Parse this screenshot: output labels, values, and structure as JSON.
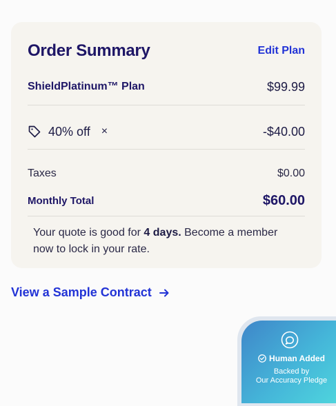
{
  "order_summary": {
    "title": "Order Summary",
    "edit_label": "Edit Plan",
    "plan_name": "ShieldPlatinum™ Plan",
    "plan_price": "$99.99",
    "discount_label": "40% off",
    "discount_remove": "×",
    "discount_amount": "-$40.00",
    "taxes_label": "Taxes",
    "taxes_value": "$0.00",
    "total_label": "Monthly Total",
    "total_value": "$60.00",
    "quote_prefix": "Your quote is good for ",
    "quote_days": "4 days.",
    "quote_suffix": " Become a member now to lock in your rate."
  },
  "contract_link": {
    "label": "View a Sample Contract"
  },
  "badge": {
    "title": "Human Added",
    "line1": "Backed by",
    "line2": "Our Accuracy Pledge"
  },
  "colors": {
    "card_bg": "#f6f4ef",
    "primary_text": "#1e1666",
    "link": "#2233d6",
    "badge_gradient_start": "#3f86c9",
    "badge_gradient_end": "#4fd6dd"
  },
  "icons": {
    "discount": "tag-icon",
    "remove": "close-icon",
    "contract": "arrow-right-icon",
    "badge": "chat-icon",
    "verified": "check-circle-icon"
  }
}
